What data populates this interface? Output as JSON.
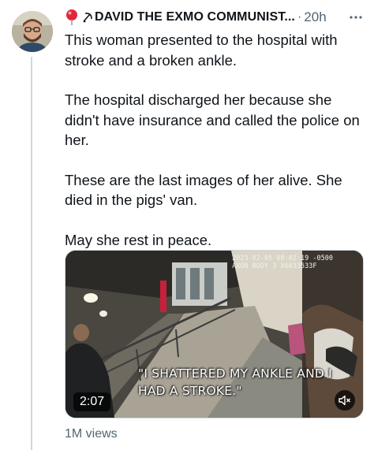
{
  "author": {
    "display_name": "DAVID THE EXMO COMMUNIST...",
    "emoji": "round-pushpin-emoji"
  },
  "meta": {
    "separator": "·",
    "time": "20h",
    "more": "more-options-icon"
  },
  "tweet": {
    "paragraphs": [
      "This woman presented to the hospital with stroke and a broken ankle.",
      "The hospital discharged her because she didn't have insurance and called the police on her.",
      "These are the last images of her alive. She died in the pigs' van.",
      "May she rest in peace."
    ]
  },
  "video": {
    "cam_line1": "2023-02-05 08:02:19 -0500",
    "cam_line2": "AXON BODY 3 X6033533F",
    "caption": "\"I SHATTERED MY ANKLE AND I HAD A STROKE.\"",
    "duration": "2:07",
    "mute_icon": "speaker-muted-icon"
  },
  "stats": {
    "views": "1M views"
  },
  "colors": {
    "text": "#0f1419",
    "secondary": "#536471",
    "thread_line": "#cfd9de",
    "pin_red": "#e2263c"
  }
}
